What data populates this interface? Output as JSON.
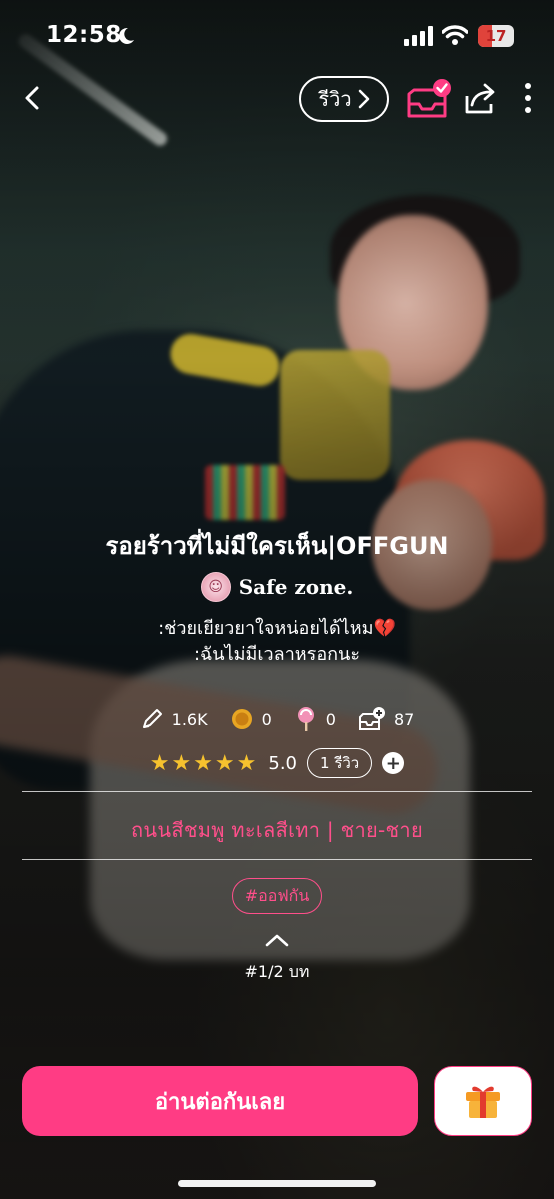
{
  "status_bar": {
    "time": "12:58",
    "battery": "17"
  },
  "nav": {
    "review_label": "รีวิว"
  },
  "story": {
    "title": "รอยร้าวที่ไม่มีใครเห็น|OFFGUN",
    "author": "Safe zone.",
    "description_line1": ":ช่วยเยียวยาใจหน่อยได้ไหม",
    "description_line2": ":ฉันไม่มีเวลาหรอกนะ"
  },
  "stats": {
    "views": "1.6K",
    "coins": "0",
    "candy": "0",
    "library": "87"
  },
  "rating": {
    "stars": 5,
    "stars_display": "★★★★★",
    "score": "5.0",
    "review_count": "1 รีวิว"
  },
  "categories": "ถนนสีชมพู ทะเลสีเทา | ชาย-ชาย",
  "tag": "#ออฟกัน",
  "chapters": "#1/2 บท",
  "actions": {
    "read_label": "อ่านต่อกันเลย"
  },
  "colors": {
    "accent": "#ff3c84",
    "star": "#f6c22e",
    "battery_low": "#e0433b"
  },
  "icons": [
    "back-chevron-icon",
    "review-chevron-icon",
    "inbox-check-icon",
    "share-icon",
    "more-vertical-icon",
    "pen-icon",
    "coin-icon",
    "lollipop-icon",
    "library-add-icon",
    "plus-icon",
    "chevron-up-icon",
    "gift-icon"
  ]
}
